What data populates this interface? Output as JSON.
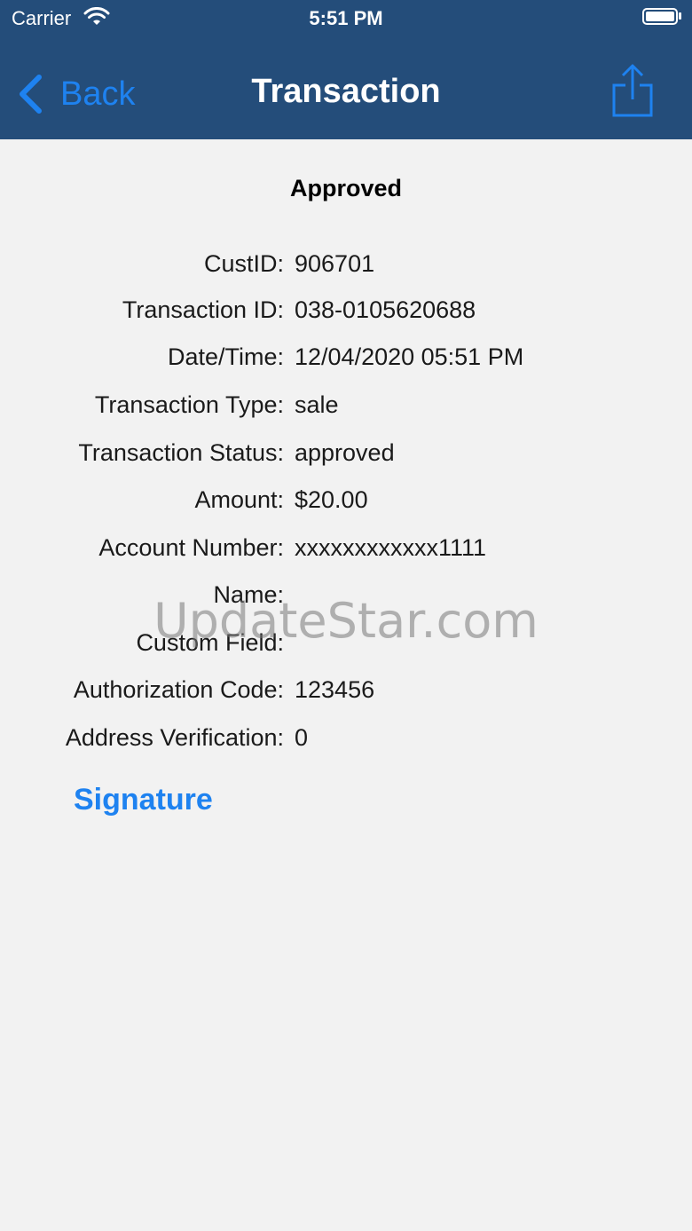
{
  "status_bar": {
    "carrier": "Carrier",
    "time": "5:51 PM"
  },
  "nav": {
    "back_label": "Back",
    "title": "Transaction"
  },
  "colors": {
    "nav_background": "#244d7a",
    "accent": "#1e82f0",
    "page_background": "#f2f2f2"
  },
  "icons": [
    "wifi-icon",
    "battery-icon",
    "chevron-left-icon",
    "share-icon"
  ],
  "transaction": {
    "result": "Approved",
    "rows": [
      {
        "label": "CustID:",
        "value": "906701"
      },
      {
        "label": "Transaction ID:",
        "value": "038-0105620688"
      },
      {
        "label": "Date/Time:",
        "value": "12/04/2020 05:51 PM"
      },
      {
        "label": "Transaction Type:",
        "value": "sale"
      },
      {
        "label": "Transaction Status:",
        "value": "approved"
      },
      {
        "label": "Amount:",
        "value": "$20.00"
      },
      {
        "label": "Account Number:",
        "value": "xxxxxxxxxxxx1111"
      },
      {
        "label": "Name:",
        "value": ""
      },
      {
        "label": "Custom Field:",
        "value": ""
      },
      {
        "label": "Authorization Code:",
        "value": "123456"
      },
      {
        "label": "Address Verification:",
        "value": "0"
      }
    ],
    "signature_label": "Signature"
  },
  "watermark": "UpdateStar.com"
}
